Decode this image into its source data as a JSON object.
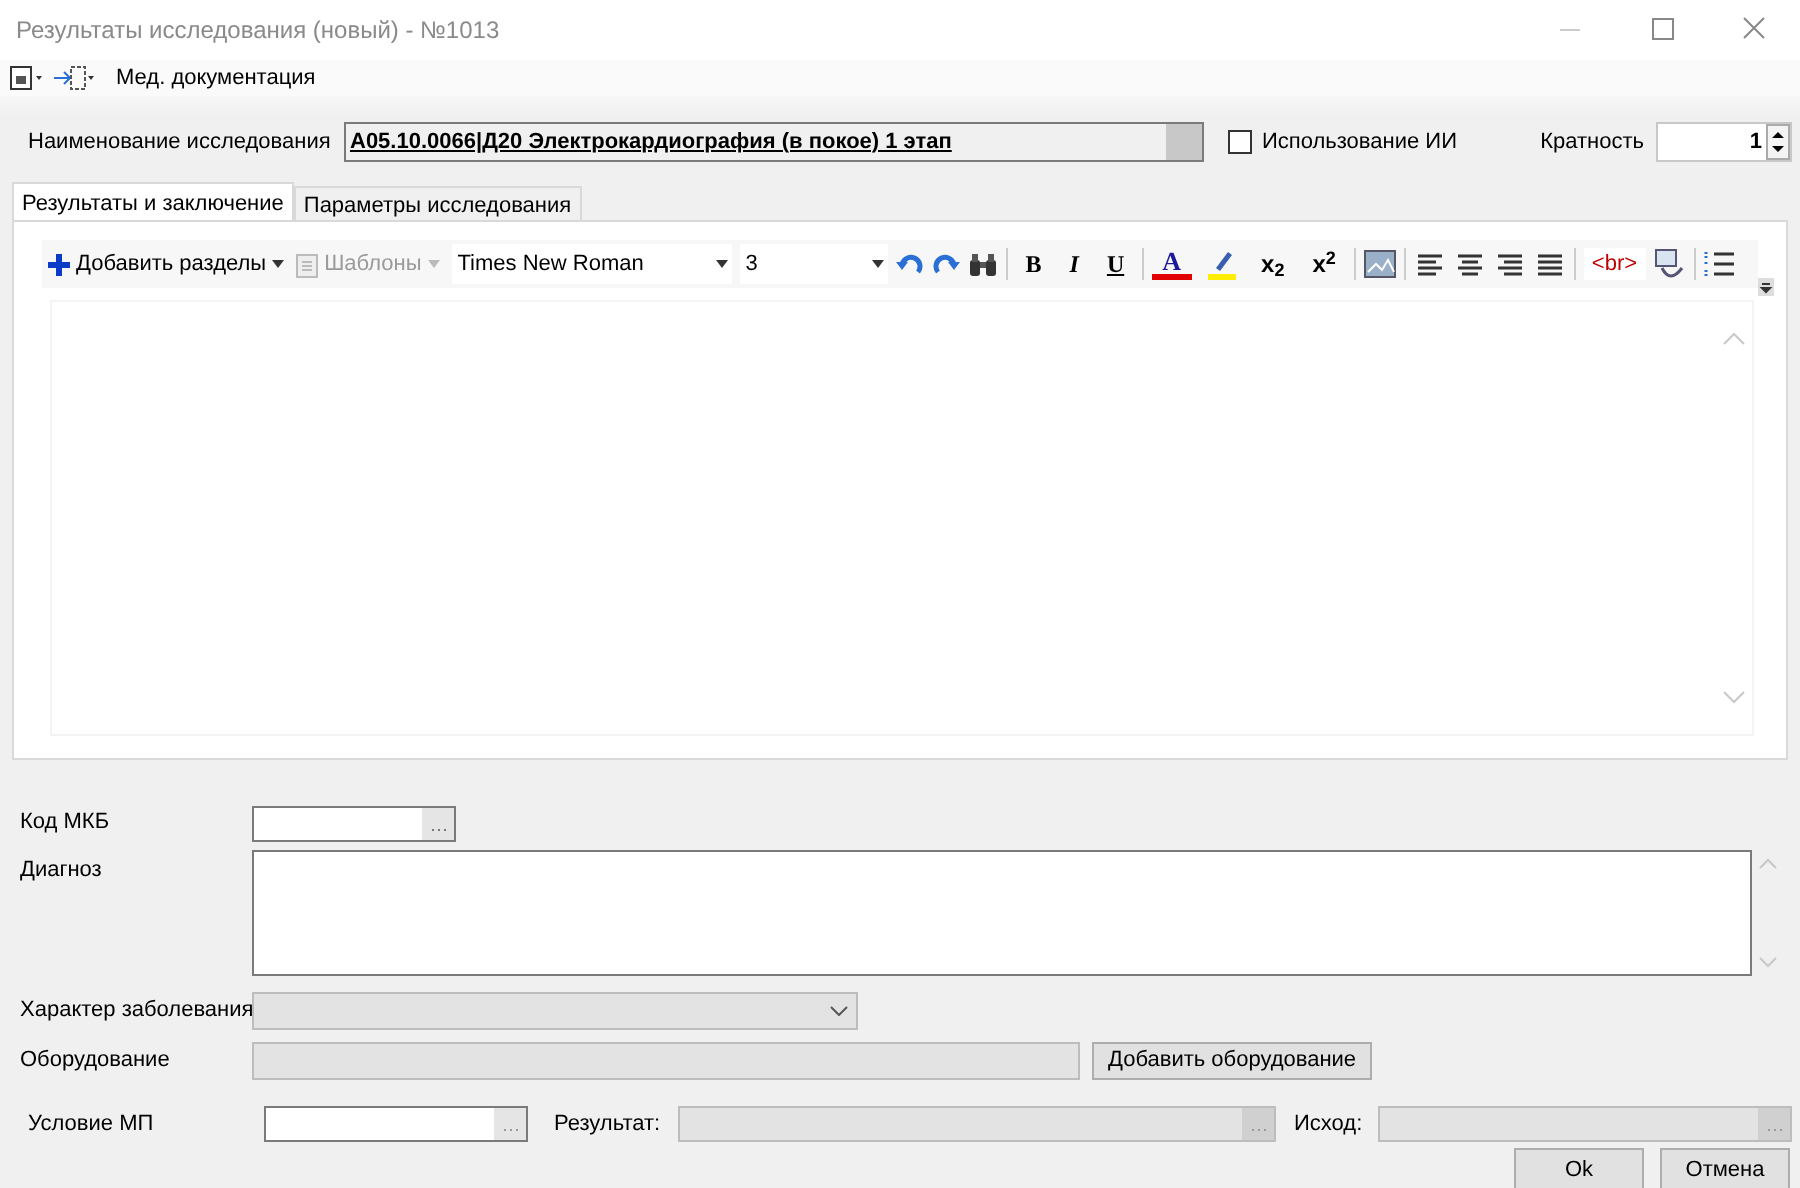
{
  "window": {
    "title": "Результаты исследования (новый) - №1013"
  },
  "toolbar": {
    "menu_label": "Мед. документация"
  },
  "study": {
    "label": "Наименование исследования",
    "value": "A05.10.0066|Д20 Электрокардиография (в покое) 1 этап",
    "ai_checkbox": {
      "label": "Использование ИИ",
      "checked": false
    },
    "multiplicity": {
      "label": "Кратность",
      "value": "1"
    }
  },
  "tabs": [
    {
      "label": "Результаты и заключение",
      "selected": true
    },
    {
      "label": "Параметры исследования",
      "selected": false
    }
  ],
  "editor_toolbar": {
    "add_sections": "Добавить разделы",
    "templates": {
      "label": "Шаблоны",
      "disabled": true
    },
    "font": "Times New Roman",
    "size": "3",
    "format_buttons": [
      {
        "kind": "bold",
        "glyph": "B"
      },
      {
        "kind": "italic",
        "glyph": "I"
      },
      {
        "kind": "underline",
        "glyph": "U"
      },
      {
        "kind": "font-color",
        "glyph": "A"
      },
      {
        "kind": "highlight"
      },
      {
        "kind": "subscript",
        "glyph": "x$_{2}$"
      },
      {
        "kind": "superscript",
        "glyph": "x$^{2}$"
      }
    ],
    "break_button": "<br>"
  },
  "form": {
    "fields": [
      {
        "label": "Код МКБ",
        "kind": "lookup",
        "disabled": false
      },
      {
        "label": "Диагноз",
        "kind": "memo",
        "disabled": false
      },
      {
        "label": "Характер заболевания",
        "kind": "combo",
        "disabled": true
      },
      {
        "label": "Оборудование",
        "kind": "text",
        "disabled": true,
        "button": "Добавить оборудование"
      }
    ],
    "bottom_row": [
      {
        "label": "Условие МП",
        "disabled": false
      },
      {
        "label": "Результат:",
        "disabled": true
      },
      {
        "label": "Исход:",
        "disabled": true
      }
    ]
  },
  "buttons": [
    "Ok",
    "Отмена"
  ]
}
